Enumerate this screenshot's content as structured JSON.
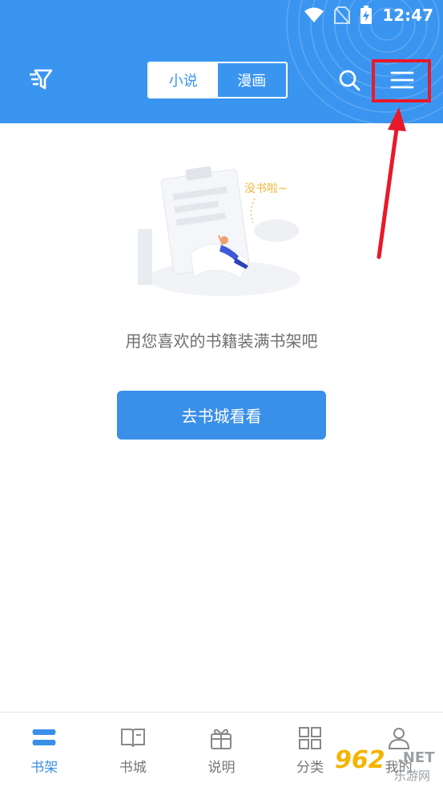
{
  "status_bar": {
    "time": "12:47"
  },
  "header": {
    "tabs": [
      {
        "label": "小说",
        "active": true
      },
      {
        "label": "漫画",
        "active": false
      }
    ],
    "icons": [
      "filter-icon",
      "search-icon",
      "menu-icon"
    ],
    "color": "#3a95f0"
  },
  "empty_state": {
    "illustration_text": "没书啦~",
    "message": "用您喜欢的书籍装满书架吧",
    "button_label": "去书城看看"
  },
  "bottom_nav": {
    "items": [
      {
        "label": "书架",
        "icon": "bookshelf-icon",
        "active": true
      },
      {
        "label": "书城",
        "icon": "open-book-icon",
        "active": false
      },
      {
        "label": "说明",
        "icon": "gift-icon",
        "active": false
      },
      {
        "label": "分类",
        "icon": "grid-icon",
        "active": false
      },
      {
        "label": "我的",
        "icon": "person-icon",
        "active": false
      }
    ]
  },
  "watermark": {
    "number": "962",
    "domain": ".NET",
    "subtitle": "乐游网"
  },
  "colors": {
    "accent": "#3a95f0",
    "highlight": "#e8192a",
    "button": "#3a8fe8"
  }
}
